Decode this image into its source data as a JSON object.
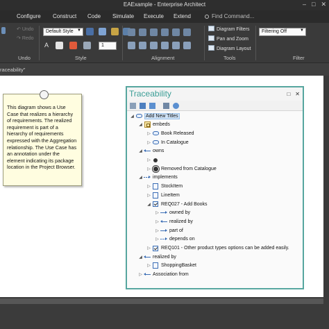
{
  "window": {
    "title": "EAExample - Enterprise Architect"
  },
  "menubar": {
    "items": [
      "Configure",
      "Construct",
      "Code",
      "Simulate",
      "Execute",
      "Extend"
    ],
    "search_placeholder": "Find Command..."
  },
  "ribbon": {
    "undo_label": "Undo",
    "redo_label": "Redo",
    "undo_group": "Undo",
    "style_combo": "Default Style",
    "line_width": "1",
    "style_group": "Style",
    "alignment_group": "Alignment",
    "tools": [
      "Diagram Filters",
      "Pan and Zoom",
      "Diagram Layout"
    ],
    "tools_group": "Tools",
    "filter_combo": "Filtering Off",
    "filter_group": "Filter"
  },
  "breadcrumb": {
    "text": "raceability\""
  },
  "note": {
    "text": "This diagram shows a Use Case that realizes a hierarchy of requirements. The realized requirement is part of a hierarchy of requirements expressed with the Aggregation relationship. The Use Case has an annotation under the element indicating its package location in the Project Browser."
  },
  "traceability": {
    "title": "Traceability",
    "tree": [
      {
        "label": "Add New Titles",
        "icon": "use-case-icon",
        "level": 0,
        "expander": "down",
        "selected": true
      },
      {
        "label": "embeds",
        "icon": "embeds-icon",
        "level": 1,
        "expander": "down"
      },
      {
        "label": "Book Released",
        "icon": "class-icon",
        "level": 2,
        "expander": "right"
      },
      {
        "label": "In Catalogue",
        "icon": "class-icon",
        "level": 2,
        "expander": "right"
      },
      {
        "label": "owns",
        "icon": "arrow-left-icon",
        "level": 1,
        "expander": "down"
      },
      {
        "label": "",
        "icon": "initial-node-icon",
        "level": 2,
        "expander": "right"
      },
      {
        "label": "Removed from Catalogue",
        "icon": "final-node-icon",
        "level": 2,
        "expander": "right"
      },
      {
        "label": "implements",
        "icon": "dashed-arrow-icon",
        "level": 1,
        "expander": "down"
      },
      {
        "label": "StockItem",
        "icon": "item-icon",
        "level": 2,
        "expander": "right"
      },
      {
        "label": "LineItem",
        "icon": "item-icon",
        "level": 2,
        "expander": "right"
      },
      {
        "label": "REQ027 - Add Books",
        "icon": "requirement-icon",
        "level": 2,
        "expander": "down"
      },
      {
        "label": "owned by",
        "icon": "arrow-right-icon",
        "level": 3,
        "expander": "right"
      },
      {
        "label": "realized by",
        "icon": "arrow-left-icon",
        "level": 3,
        "expander": "right"
      },
      {
        "label": "part of",
        "icon": "arrow-right-icon",
        "level": 3,
        "expander": "right"
      },
      {
        "label": "depends on",
        "icon": "dashed-arrow-icon",
        "level": 3,
        "expander": "right"
      },
      {
        "label": "REQ101 - Other product types options can be added easily.",
        "icon": "requirement-icon",
        "level": 2,
        "expander": "right"
      },
      {
        "label": "realized by",
        "icon": "arrow-left-icon",
        "level": 1,
        "expander": "down"
      },
      {
        "label": "ShoppingBasket",
        "icon": "item-icon",
        "level": 2,
        "expander": "right"
      },
      {
        "label": "Association from",
        "icon": "arrow-left-icon",
        "level": 1,
        "expander": "right"
      }
    ]
  },
  "colors": {
    "panel_border": "#56a69f",
    "panel_title": "#3b9e96",
    "note_fill": "#fffde0",
    "chrome_dark": "#2b2b2b",
    "icon_blue": "#3a6db5"
  }
}
